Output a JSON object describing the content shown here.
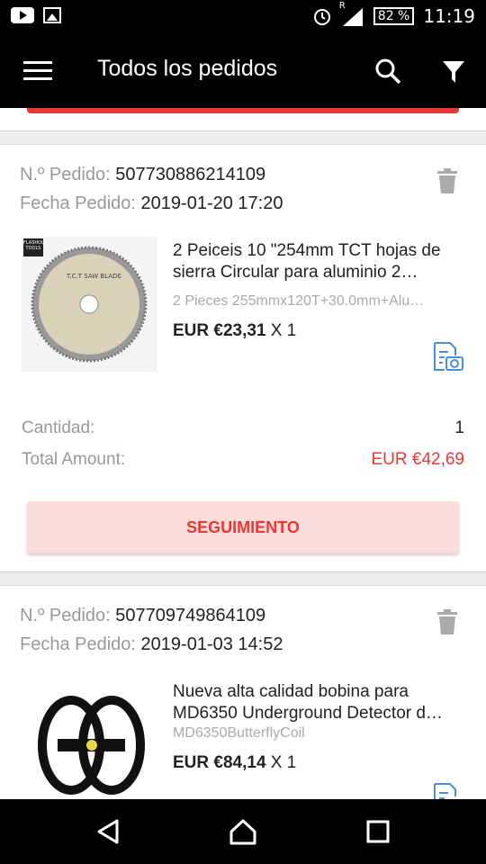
{
  "status_bar": {
    "battery": "82 %",
    "time": "11:19",
    "signal_label": "R"
  },
  "app_bar": {
    "title": "Todos los pedidos",
    "menu_icon": "menu-icon",
    "search_icon": "search-icon",
    "filter_icon": "filter-icon"
  },
  "orders": [
    {
      "order_label": "N.º Pedido:",
      "order_number": "507730886214109",
      "date_label": "Fecha Pedido:",
      "date": "2019-01-20 17:20",
      "product_title": "2 Peiceis 10 \"254mm TCT hojas de sierra Circular para aluminio 2…",
      "product_sku": "2 Pieces 255mmx120T+30.0mm+Alu…",
      "price": "EUR €23,31",
      "qty": "X 1",
      "quantity_label": "Cantidad:",
      "quantity_value": "1",
      "total_label": "Total Amount:",
      "total_value": "EUR €42,69",
      "track_button": "SEGUIMIENTO",
      "image_text": "T.C.T SAW BLADE",
      "image_logo": "FLASHOL TOOLS"
    },
    {
      "order_label": "N.º Pedido:",
      "order_number": "507709749864109",
      "date_label": "Fecha Pedido:",
      "date": "2019-01-03 14:52",
      "product_title": "Nueva alta calidad bobina para MD6350 Underground Detector d…",
      "product_sku": "MD6350ButterflyCoil",
      "price": "EUR €84,14",
      "qty": "X 1"
    }
  ],
  "colors": {
    "accent_red": "#e53935",
    "track_bg": "#fddcdc",
    "review_blue": "#4a90d9"
  }
}
